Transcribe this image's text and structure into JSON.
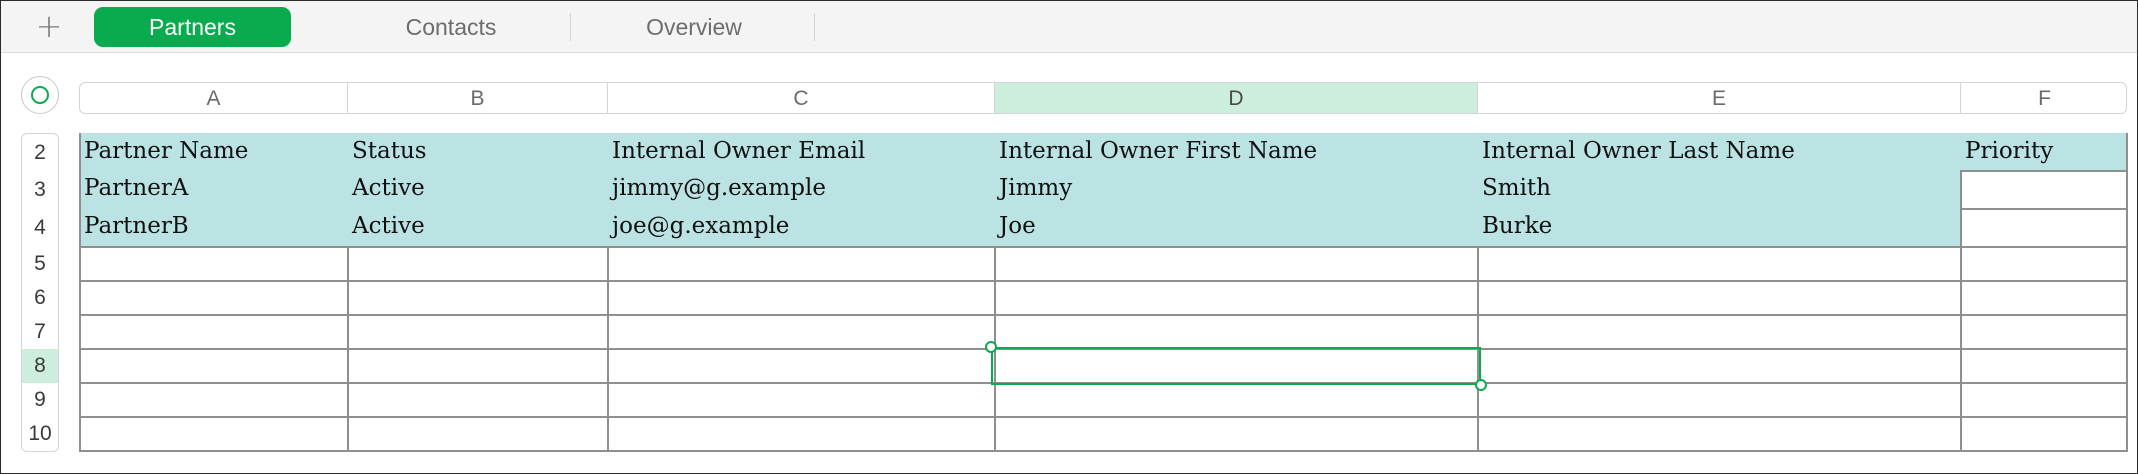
{
  "tabbar": {
    "add_label": "+",
    "tabs": [
      {
        "label": "Partners",
        "active": true
      },
      {
        "label": "Contacts",
        "active": false
      },
      {
        "label": "Overview",
        "active": false
      }
    ]
  },
  "colors": {
    "accent": "#0aab4f",
    "header_band": "#bce3e4",
    "selected_header": "#cdeedd"
  },
  "columns": [
    "A",
    "B",
    "C",
    "D",
    "E",
    "F"
  ],
  "selected_column": "D",
  "rows": [
    "2",
    "3",
    "4",
    "5",
    "6",
    "7",
    "8",
    "9",
    "10"
  ],
  "selected_row": "8",
  "selected_cell": "D8",
  "table": {
    "headers": [
      "Partner Name",
      "Status",
      "Internal Owner Email",
      "Internal Owner First Name",
      "Internal Owner Last Name",
      "Priority"
    ],
    "records": [
      [
        "PartnerA",
        "Active",
        "jimmy@g.example",
        "Jimmy",
        "Smith",
        ""
      ],
      [
        "PartnerB",
        "Active",
        "joe@g.example",
        "Joe",
        "Burke",
        ""
      ]
    ]
  }
}
